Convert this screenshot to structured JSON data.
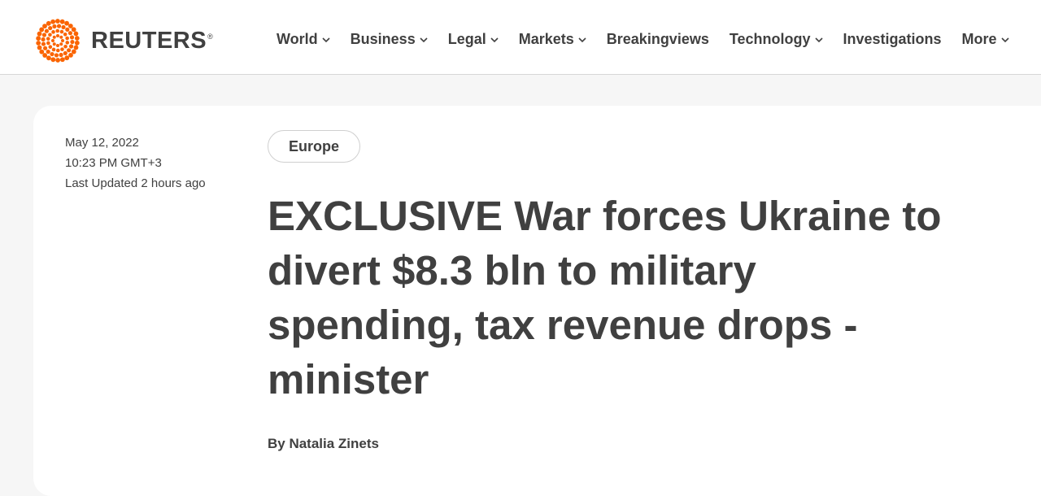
{
  "brand": {
    "name": "REUTERS",
    "mark": "®",
    "color": "#fa6400"
  },
  "nav": [
    {
      "label": "World",
      "dropdown": true
    },
    {
      "label": "Business",
      "dropdown": true
    },
    {
      "label": "Legal",
      "dropdown": true
    },
    {
      "label": "Markets",
      "dropdown": true
    },
    {
      "label": "Breakingviews",
      "dropdown": false
    },
    {
      "label": "Technology",
      "dropdown": true
    },
    {
      "label": "Investigations",
      "dropdown": false
    },
    {
      "label": "More",
      "dropdown": true
    }
  ],
  "article": {
    "date": "May 12, 2022",
    "time": "10:23 PM GMT+3",
    "updated": "Last Updated 2 hours ago",
    "section": "Europe",
    "headline": "EXCLUSIVE War forces Ukraine to divert $8.3 bln to military spending, tax revenue drops - minister",
    "byline": "By Natalia Zinets"
  }
}
